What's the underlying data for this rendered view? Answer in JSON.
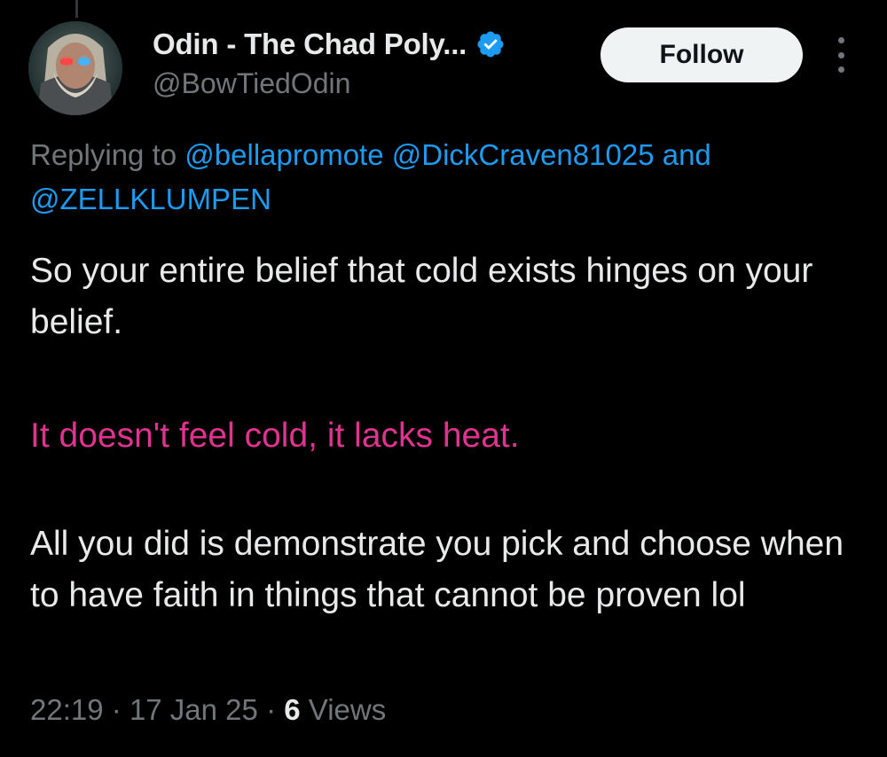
{
  "author": {
    "display_name": "Odin - The Chad Poly...",
    "handle": "@BowTiedOdin",
    "verified_icon": "verified-badge-icon",
    "avatar": "avatar-image"
  },
  "actions": {
    "follow_label": "Follow",
    "more_icon": "more-options-icon"
  },
  "reply": {
    "prefix": "Replying to",
    "mention_1": "@bellapromote",
    "mention_2": "@DickCraven81025",
    "conjunction": "and",
    "mention_3": "@ZELLKLUMPEN"
  },
  "tweet": {
    "paragraph_1": "So your entire belief that cold exists hinges on your belief.",
    "paragraph_2": "It doesn't feel cold, it lacks heat.",
    "paragraph_3": "All you did is demonstrate you pick and choose when to have faith in things that cannot be proven lol"
  },
  "meta": {
    "time": "22:19",
    "date": "17 Jan 25",
    "views_count": "6",
    "views_label": "Views",
    "separator": "·"
  },
  "colors": {
    "background": "#000000",
    "text_primary": "#e7e9ea",
    "text_secondary": "#71767b",
    "mention": "#1d9bf0",
    "highlight_text": "#e0338f",
    "follow_bg": "#eff3f4",
    "verified": "#1d9bf0"
  }
}
